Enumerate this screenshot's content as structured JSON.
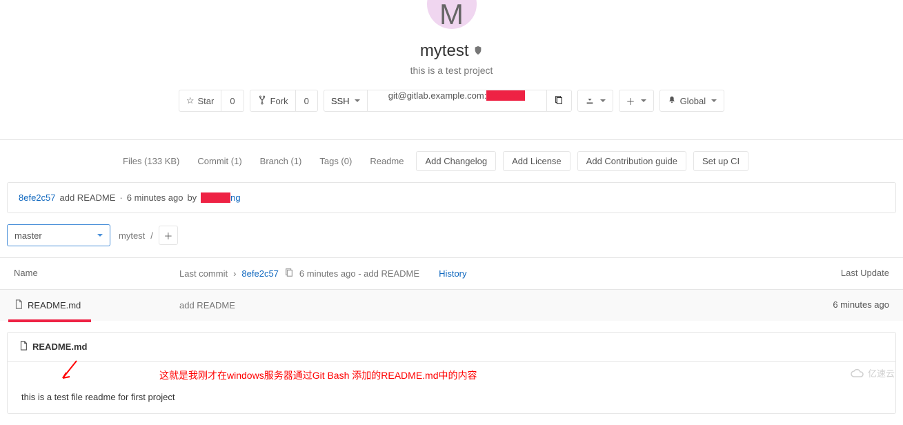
{
  "project": {
    "avatar_letter": "M",
    "name": "mytest",
    "description": "this is a test project"
  },
  "actions": {
    "star_label": "Star",
    "star_count": "0",
    "fork_label": "Fork",
    "fork_count": "0",
    "protocol": "SSH",
    "clone_url_prefix": "git@gitlab.example.com:",
    "notification_label": "Global"
  },
  "tabs": {
    "files": "Files (133 KB)",
    "commit": "Commit (1)",
    "branch": "Branch (1)",
    "tags": "Tags (0)",
    "readme": "Readme",
    "add_changelog": "Add Changelog",
    "add_license": "Add License",
    "add_contrib": "Add Contribution guide",
    "setup_ci": "Set up CI"
  },
  "last_commit": {
    "sha": "8efe2c57",
    "message": "add README",
    "time": "6 minutes ago",
    "by_label": "by",
    "author_suffix": "ng"
  },
  "branch": {
    "current": "master",
    "breadcrumb": "mytest",
    "sep": "/"
  },
  "table": {
    "col_name": "Name",
    "col_commit_label": "Last commit",
    "commit_sha": "8efe2c57",
    "commit_info": "6 minutes ago - add README",
    "history": "History",
    "col_update": "Last Update"
  },
  "files": [
    {
      "name": "README.md",
      "commit_msg": "add README",
      "updated": "6 minutes ago"
    }
  ],
  "readme": {
    "filename": "README.md",
    "content": "this is a test file readme for first project",
    "annotation": "这就是我刚才在windows服务器通过Git Bash 添加的README.md中的内容"
  },
  "watermark": "亿速云"
}
